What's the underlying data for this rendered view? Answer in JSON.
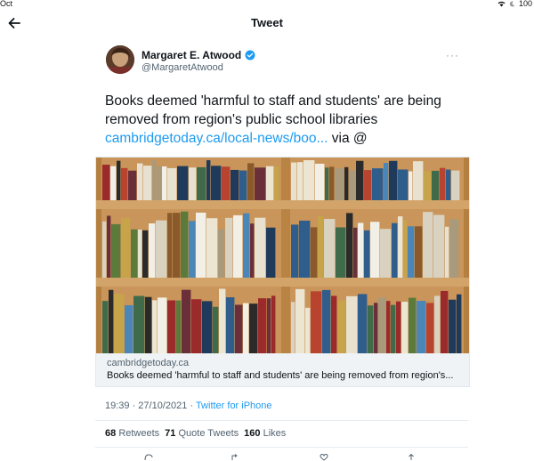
{
  "status_bar": {
    "time_fragment": "Oct",
    "battery": "100"
  },
  "header": {
    "title": "Tweet"
  },
  "tweet": {
    "author": {
      "display_name": "Margaret E. Atwood",
      "handle": "@MargaretAtwood"
    },
    "text": "Books deemed 'harmful to staff and students' are being removed from region's public school libraries",
    "link": "cambridgetoday.ca/local-news/boo...",
    "after_link": " via @",
    "card": {
      "domain": "cambridgetoday.ca",
      "title": "Books deemed 'harmful to staff and students' are being removed from region's..."
    },
    "time": "19:39 · 27/10/2021 · ",
    "source": "Twitter for iPhone",
    "stats": {
      "retweets": "68",
      "retweets_label": "Retweets",
      "quotes": "71",
      "quotes_label": "Quote Tweets",
      "likes": "160",
      "likes_label": "Likes"
    }
  },
  "colors": {
    "accent": "#1d9bf0",
    "muted": "#536471",
    "card_meta_bg": "#f0f3f5"
  },
  "icons": [
    "wifi-icon",
    "moon-icon",
    "back-arrow-icon",
    "verified-icon",
    "more-icon",
    "reply-icon",
    "retweet-icon",
    "like-icon",
    "share-icon"
  ]
}
